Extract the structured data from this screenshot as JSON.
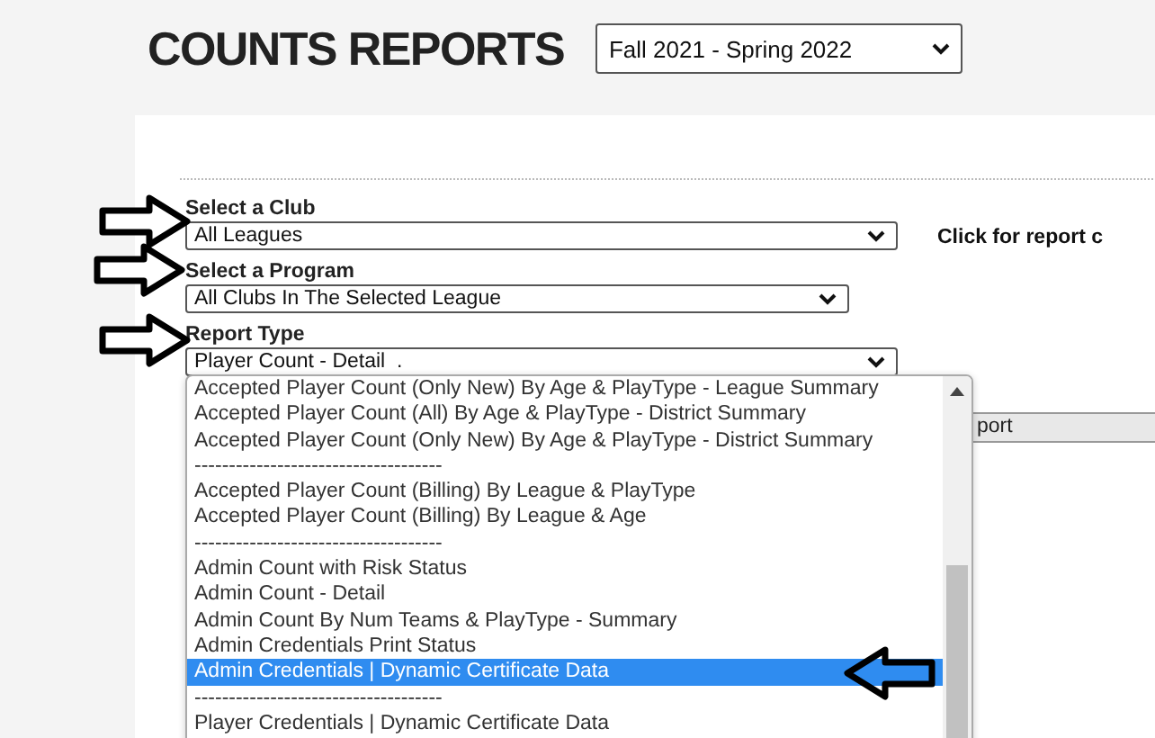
{
  "title": "COUNTS REPORTS",
  "season": {
    "value": "Fall 2021 - Spring 2022"
  },
  "filters": [
    {
      "label": "Select a Club",
      "value": "All Leagues"
    },
    {
      "label": "Select a Program",
      "value": "All Clubs In The Selected League"
    },
    {
      "label": "Report Type",
      "value": "Player Count - Detail  ."
    }
  ],
  "report_hint": "Click for report c",
  "table_header": "port",
  "options": [
    {
      "text": "Accepted Player Count (Only New) By Age & PlayType - League Summary",
      "selected": false
    },
    {
      "text": "Accepted Player Count (All) By Age & PlayType - District Summary",
      "selected": false
    },
    {
      "text": "Accepted Player Count (Only New) By Age & PlayType - District Summary",
      "selected": false
    },
    {
      "text": "------------------------------------",
      "selected": false
    },
    {
      "text": "Accepted Player Count (Billing) By League & PlayType",
      "selected": false
    },
    {
      "text": "Accepted Player Count (Billing) By League & Age",
      "selected": false
    },
    {
      "text": "------------------------------------",
      "selected": false
    },
    {
      "text": "Admin Count with Risk Status",
      "selected": false
    },
    {
      "text": "Admin Count - Detail",
      "selected": false
    },
    {
      "text": "Admin Count By Num Teams & PlayType - Summary",
      "selected": false
    },
    {
      "text": "Admin Credentials Print Status",
      "selected": false
    },
    {
      "text": "Admin Credentials | Dynamic Certificate Data",
      "selected": true
    },
    {
      "text": "------------------------------------",
      "selected": false
    },
    {
      "text": "Player Credentials | Dynamic Certificate Data",
      "selected": false
    }
  ]
}
